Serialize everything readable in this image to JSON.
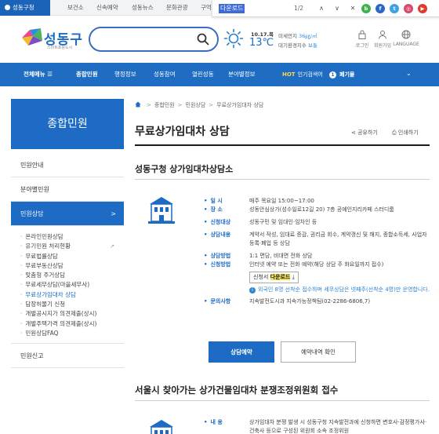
{
  "topbar": {
    "tabs": [
      "성동구청",
      "보건소",
      "신속예약",
      "성동뉴스",
      "문화관광",
      "구억"
    ]
  },
  "findbar": {
    "query": "다운로드",
    "count": "1/2",
    "up": "∧",
    "down": "∨",
    "close": "✕"
  },
  "social": {
    "colors": [
      "#3fb24e",
      "#2a67c6",
      "#3ea3e6",
      "#d64a6b"
    ],
    "labels": [
      "b",
      "f",
      "t",
      "◎"
    ]
  },
  "header": {
    "logo": "성동구",
    "logo_sub": "스마트포용도시",
    "date": "10.17.",
    "date_day": "목",
    "temp": "13℃",
    "dust_label": "미세먼지",
    "dust_value": "36㎍/㎥",
    "air_label": "대기환경지수",
    "air_value": "보통",
    "util": [
      "로그인",
      "회원가입",
      "LANGUAGE"
    ]
  },
  "gnb": {
    "all_menu": "전체메뉴",
    "items": [
      "종합민원",
      "행정정보",
      "성동참여",
      "열린성동",
      "분야별정보"
    ],
    "hot_label": "HOT",
    "hot_text": "인기검색어",
    "kw_num": "1",
    "kw": "폐기물"
  },
  "sidebar": {
    "title": "종합민원",
    "items": [
      "민원안내",
      "분야별민원",
      "민원상담"
    ],
    "arrow": ">",
    "sub": [
      "온라인민원상담",
      "유기민원 처리현황",
      "무료법률상담",
      "무료부동산상담",
      "맞춤형 주거상담",
      "무료세무상담(마을세무사)",
      "무료상가임대차 상담",
      "담장허물기 신청",
      "개별공시지가 의견제출(상시)",
      "개별주택가격 의견제출(상시)",
      "민원상담FAQ"
    ],
    "sub_ext": "↗",
    "last": "민원신고"
  },
  "main": {
    "breadcrumb": [
      "종합민원",
      "민원상담",
      "무료상가임대차 상담"
    ],
    "bc_sep": ">",
    "title": "무료상가임대차 상담",
    "share": "공유하기",
    "print": "인쇄하기",
    "section1": "성동구청 상가임대차상담소",
    "rows": [
      {
        "k": "일 시",
        "v": "매주 목요일 15:00~17:00"
      },
      {
        "k": "장 소",
        "v": "성동안심상가(성수일로12길 20) 7층 공예인지리카페 스터디룸"
      },
      {
        "k": "신청대상",
        "v": "성동구민 및 임대인·임차인 등"
      },
      {
        "k": "상담내용",
        "v": "계약서 작성, 임대료 증감, 권리금 회수, 계약갱신 및 해지, 종합소득세, 사업자 등록·폐업 등 상담"
      },
      {
        "k": "상담방법",
        "v": "1:1 면담, 비대면 전화 상담"
      },
      {
        "k": "신청방법",
        "v": "인터넷 예약 또는 전화 예약(해당 상담 주 화요일까지 접수)"
      }
    ],
    "dl_label": "신청서",
    "dl_hl": "다운로드",
    "dl_icon": "⤓",
    "notice_i": "i",
    "notice": "외국인 8명 선착순 접수하며 세무상담은 넷째주(선착순 4명)만 운영합니다.",
    "contact_k": "문의사항",
    "contact_v": "지속발전도시과 지속가능정책팀(02-2286-6806,7)",
    "btn_reserve": "상담예약",
    "btn_check": "예약내역 확인",
    "section2": "서울시 찾아가는 상가건물임대차 분쟁조정위원회 접수",
    "row2_k": "내 용",
    "row2_v": "상가임대차 분쟁 발생 시 성동구청 지속발전과에 신청하면 변호사·감정평가사·건축사 등으로 구성된 위원회 소속 조정위원"
  }
}
